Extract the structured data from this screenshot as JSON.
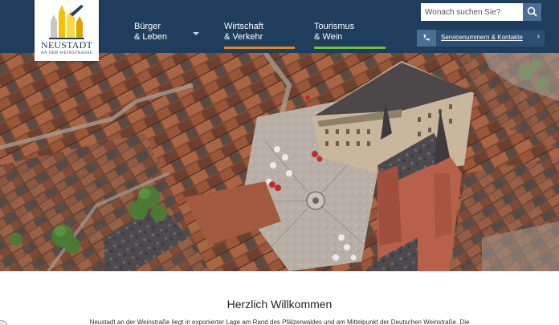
{
  "logo": {
    "name": "NEUSTADT",
    "subtitle": "AN DER WEINSTRASSE",
    "icon": "city-arms-logo"
  },
  "nav": [
    {
      "line1": "Bürger",
      "line2": "& Leben",
      "accent": "#1f3d5c"
    },
    {
      "line1": "Wirtschaft",
      "line2": "& Verkehr",
      "accent": "#e08a1e"
    },
    {
      "line1": "Tourismus",
      "line2": "& Wein",
      "accent": "#6fbf3a"
    }
  ],
  "search": {
    "placeholder": "Wonach suchen Sie?",
    "icon": "search-icon"
  },
  "service": {
    "label": "Servicenummern & Kontakte",
    "icon": "phone-icon",
    "arrow": "›"
  },
  "hero": {
    "alt": "aerial-view-old-town"
  },
  "welcome": {
    "title": "Herzlich Willkommen",
    "text": "Neustadt an der Weinstraße liegt in exponierter Lage am Rand des Pfälzerwaldes und am Mittelpunkt der Deutschen Weinstraße. Die"
  },
  "colors": {
    "header": "#1f3d5c",
    "service": "#2b4f72",
    "accent_orange": "#e08a1e",
    "accent_green": "#6fbf3a"
  }
}
